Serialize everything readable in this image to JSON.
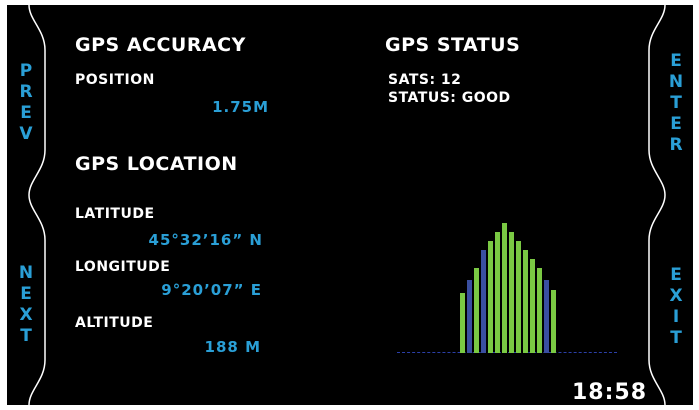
{
  "nav": {
    "prev": "PREV",
    "next": "NEXT",
    "enter": "ENTER",
    "exit": "EXIT"
  },
  "accuracy": {
    "title": "GPS ACCURACY",
    "position_label": "POSITION",
    "position_value": "1.75M"
  },
  "location": {
    "title": "GPS LOCATION",
    "latitude_label": "LATITUDE",
    "latitude_value": "45°32’16” N",
    "longitude_label": "LONGITUDE",
    "longitude_value": "9°20’07” E",
    "altitude_label": "ALTITUDE",
    "altitude_value": "188 M"
  },
  "status": {
    "title": "GPS STATUS",
    "sats_line": "SATS: 12",
    "status_line": "STATUS: GOOD"
  },
  "clock": "18:58",
  "colors": {
    "background": "#000000",
    "accent": "#2a9fd6",
    "text": "#ffffff",
    "bar_green": "#7ac943",
    "bar_blue": "#3a4fa0"
  },
  "chart_data": {
    "type": "bar",
    "series": [
      {
        "values": [
          10,
          12,
          14,
          17,
          18.5,
          20,
          21.5,
          20,
          18.5,
          17,
          15.5,
          14,
          12,
          10.5
        ],
        "colors": [
          "green",
          "blue",
          "green",
          "blue",
          "green",
          "green",
          "green",
          "green",
          "green",
          "green",
          "green",
          "green",
          "blue",
          "green"
        ]
      }
    ],
    "ylim": [
      0,
      21.5
    ]
  }
}
